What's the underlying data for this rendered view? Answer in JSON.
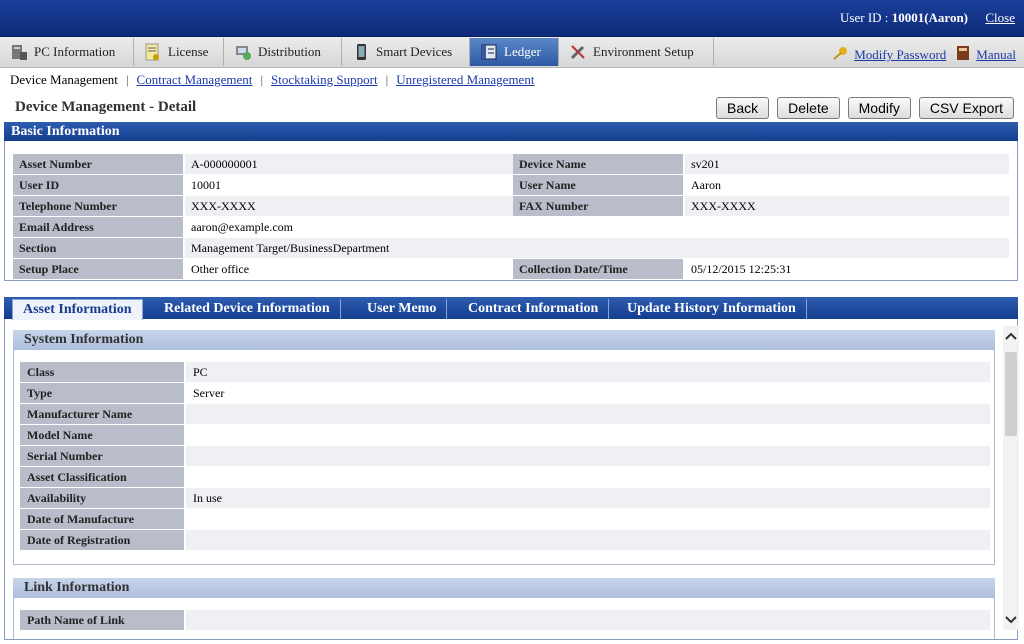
{
  "header": {
    "user_label": "User ID : ",
    "user_value": "10001(Aaron)",
    "close_label": "Close"
  },
  "main_tabs": [
    {
      "label": "PC Information",
      "icon": "pc-icon"
    },
    {
      "label": "License",
      "icon": "license-icon"
    },
    {
      "label": "Distribution",
      "icon": "distribution-icon"
    },
    {
      "label": "Smart Devices",
      "icon": "smartphone-icon"
    },
    {
      "label": "Ledger",
      "icon": "ledger-icon"
    },
    {
      "label": "Environment Setup",
      "icon": "tools-icon"
    }
  ],
  "right_links": {
    "modify_password": "Modify Password",
    "manual": "Manual"
  },
  "sub_nav": {
    "current": "Device Management",
    "links": [
      "Contract Management",
      "Stocktaking Support",
      "Unregistered Management"
    ]
  },
  "page": {
    "title": "Device Management - Detail",
    "buttons": [
      "Back",
      "Delete",
      "Modify",
      "CSV Export"
    ]
  },
  "basic_info": {
    "header": "Basic Information",
    "asset_number_label": "Asset Number",
    "asset_number": "A-000000001",
    "device_name_label": "Device Name",
    "device_name": "sv201",
    "user_id_label": "User ID",
    "user_id": "10001",
    "user_name_label": "User Name",
    "user_name": "Aaron",
    "telephone_label": "Telephone Number",
    "telephone": "XXX-XXXX",
    "fax_label": "FAX Number",
    "fax": "XXX-XXXX",
    "email_label": "Email Address",
    "email": "aaron@example.com",
    "section_label": "Section",
    "section": "Management Target/BusinessDepartment",
    "setup_place_label": "Setup Place",
    "setup_place": "Other office",
    "collection_label": "Collection Date/Time",
    "collection": "05/12/2015 12:25:31"
  },
  "detail_tabs": [
    "Asset Information",
    "Related Device Information",
    "User Memo",
    "Contract Information",
    "Update History Information"
  ],
  "system_info": {
    "header": "System Information",
    "rows": [
      {
        "label": "Class",
        "value": "PC"
      },
      {
        "label": "Type",
        "value": "Server"
      },
      {
        "label": "Manufacturer Name",
        "value": ""
      },
      {
        "label": "Model Name",
        "value": ""
      },
      {
        "label": "Serial Number",
        "value": ""
      },
      {
        "label": "Asset Classification",
        "value": ""
      },
      {
        "label": "Availability",
        "value": "In use"
      },
      {
        "label": "Date of Manufacture",
        "value": ""
      },
      {
        "label": "Date of Registration",
        "value": ""
      }
    ]
  },
  "link_info": {
    "header": "Link Information",
    "rows": [
      {
        "label": "Path Name of Link",
        "value": ""
      }
    ]
  }
}
